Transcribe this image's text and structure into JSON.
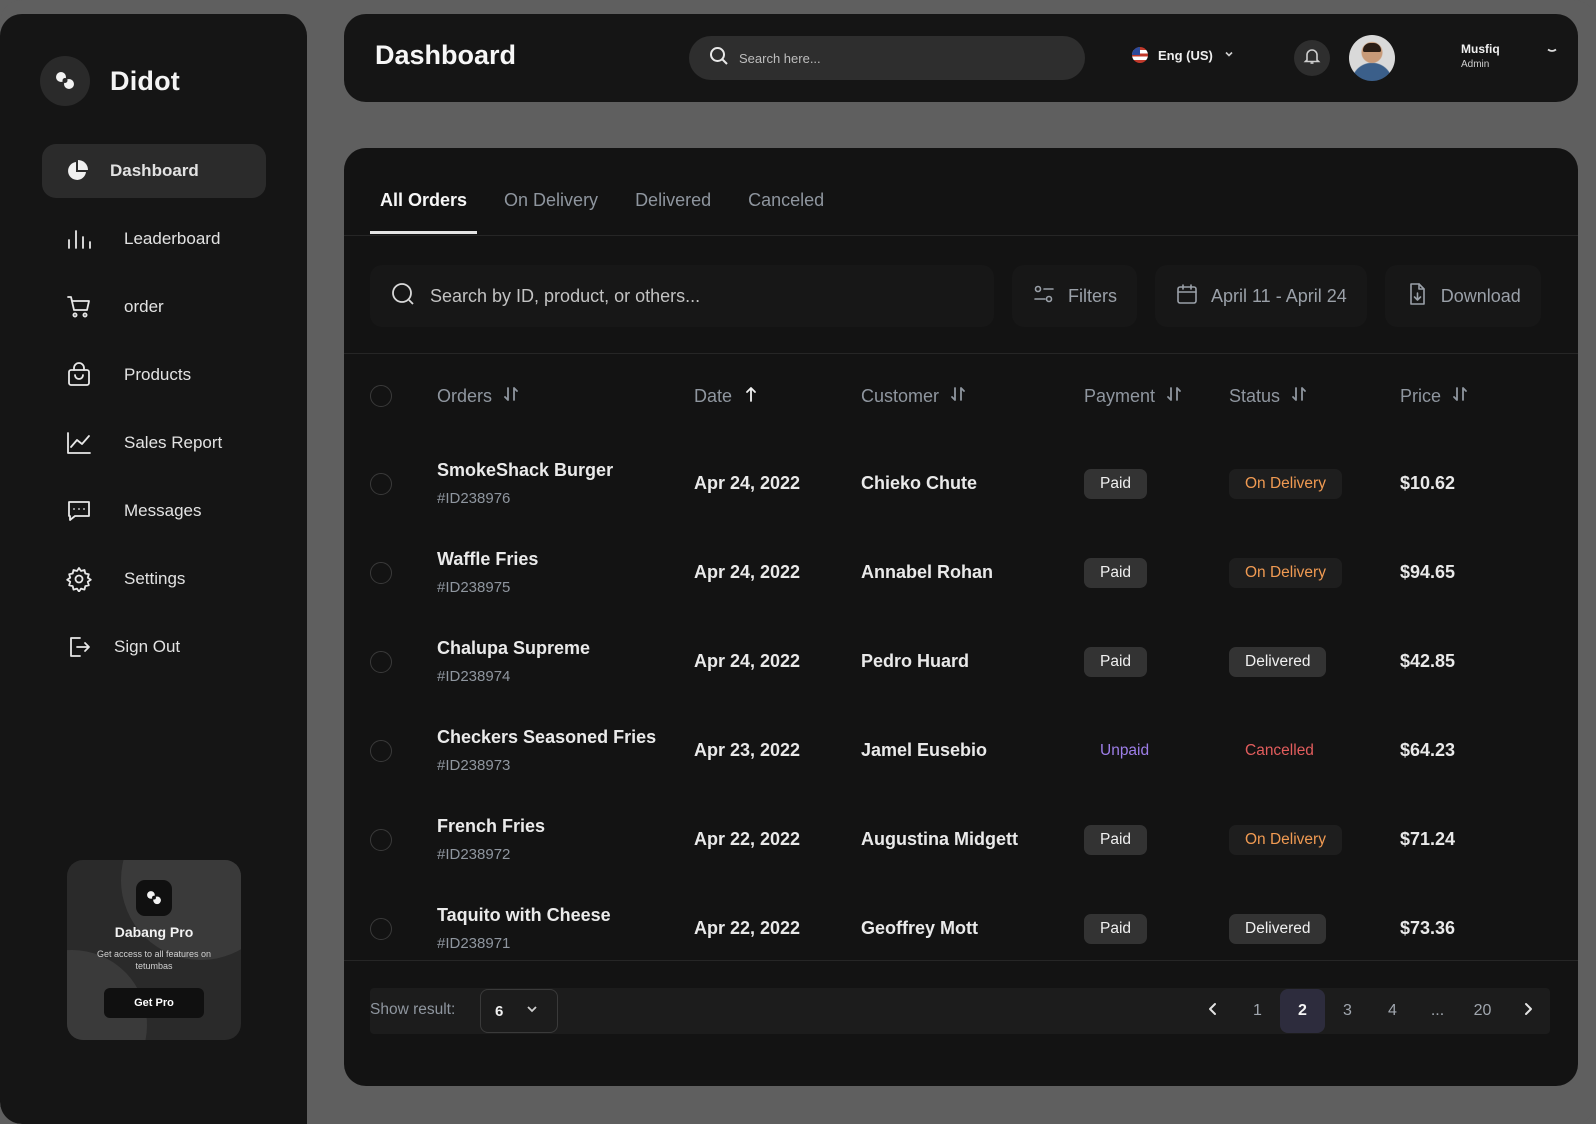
{
  "brand": {
    "name": "Didot"
  },
  "sidebar": {
    "items": [
      {
        "label": "Dashboard",
        "icon": "pie-chart-icon",
        "active": true
      },
      {
        "label": "Leaderboard",
        "icon": "bar-chart-icon"
      },
      {
        "label": "order",
        "icon": "cart-icon"
      },
      {
        "label": "Products",
        "icon": "shopping-bag-icon"
      },
      {
        "label": "Sales Report",
        "icon": "line-chart-icon"
      },
      {
        "label": "Messages",
        "icon": "message-icon"
      },
      {
        "label": "Settings",
        "icon": "gear-icon"
      },
      {
        "label": "Sign Out",
        "icon": "sign-out-icon"
      }
    ],
    "promo": {
      "title": "Dabang Pro",
      "description": "Get access to all features on tetumbas",
      "button": "Get Pro"
    }
  },
  "header": {
    "title": "Dashboard",
    "search_placeholder": "Search here...",
    "language": "Eng (US)",
    "user": {
      "name": "Musfiq",
      "role": "Admin"
    }
  },
  "orders": {
    "tabs": [
      {
        "label": "All Orders",
        "active": true
      },
      {
        "label": "On Delivery"
      },
      {
        "label": "Delivered"
      },
      {
        "label": "Canceled"
      }
    ],
    "search_placeholder": "Search by ID, product, or others...",
    "filters_label": "Filters",
    "date_range": "April 11 - April 24",
    "download_label": "Download",
    "columns": {
      "orders": "Orders",
      "date": "Date",
      "customer": "Customer",
      "payment": "Payment",
      "status": "Status",
      "price": "Price"
    },
    "rows": [
      {
        "product": "SmokeShack Burger",
        "id": "#ID238976",
        "date": "Apr 24, 2022",
        "customer": "Chieko Chute",
        "payment": "Paid",
        "status": "On Delivery",
        "price": "$10.62"
      },
      {
        "product": "Waffle Fries",
        "id": "#ID238975",
        "date": "Apr 24, 2022",
        "customer": "Annabel Rohan",
        "payment": "Paid",
        "status": "On Delivery",
        "price": "$94.65"
      },
      {
        "product": "Chalupa Supreme",
        "id": "#ID238974",
        "date": "Apr 24, 2022",
        "customer": "Pedro Huard",
        "payment": "Paid",
        "status": "Delivered",
        "price": "$42.85"
      },
      {
        "product": "Checkers Seasoned Fries",
        "id": "#ID238973",
        "date": "Apr 23, 2022",
        "customer": "Jamel Eusebio",
        "payment": "Unpaid",
        "status": "Cancelled",
        "price": "$64.23"
      },
      {
        "product": "French Fries",
        "id": "#ID238972",
        "date": "Apr 22, 2022",
        "customer": "Augustina Midgett",
        "payment": "Paid",
        "status": "On Delivery",
        "price": "$71.24"
      },
      {
        "product": "Taquito with Cheese",
        "id": "#ID238971",
        "date": "Apr 22, 2022",
        "customer": "Geoffrey Mott",
        "payment": "Paid",
        "status": "Delivered",
        "price": "$73.36"
      }
    ],
    "pagination": {
      "show_label": "Show result:",
      "page_size": "6",
      "pages": [
        "1",
        "2",
        "3",
        "4",
        "...",
        "20"
      ],
      "current": "2"
    }
  },
  "colors": {
    "background": "#5f5f5f",
    "panel": "#151515",
    "on_delivery": "#f09a52",
    "cancelled": "#e25d5d",
    "unpaid": "#9d7ee8",
    "active_page": "#2d2c3d"
  }
}
